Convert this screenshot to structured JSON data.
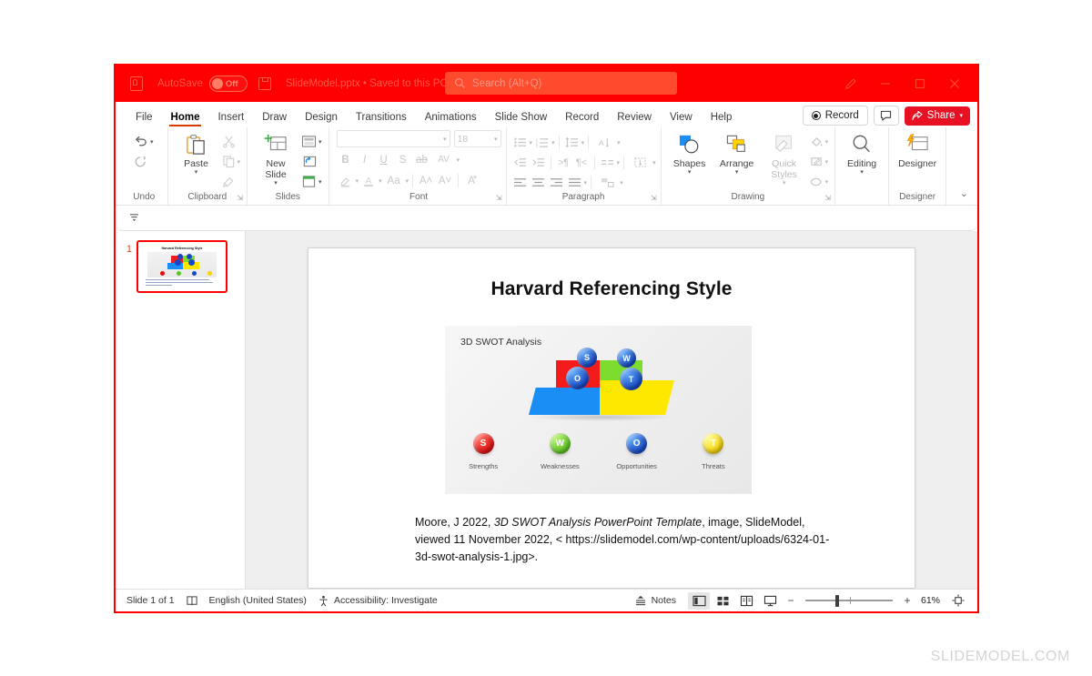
{
  "titlebar": {
    "app_icon": "powerpoint-icon",
    "autosave_label": "AutoSave",
    "autosave_state": "Off",
    "save_icon": "save-icon",
    "document_title": "SlideModel.pptx  •  Saved to this PC",
    "search_placeholder": "Search (Alt+Q)",
    "brand_color": "#ff0000",
    "window_controls": [
      "ribbon-display-options",
      "minimize",
      "maximize",
      "close"
    ]
  },
  "tabs": [
    {
      "label": "File",
      "active": false
    },
    {
      "label": "Home",
      "active": true
    },
    {
      "label": "Insert",
      "active": false
    },
    {
      "label": "Draw",
      "active": false
    },
    {
      "label": "Design",
      "active": false
    },
    {
      "label": "Transitions",
      "active": false
    },
    {
      "label": "Animations",
      "active": false
    },
    {
      "label": "Slide Show",
      "active": false
    },
    {
      "label": "Record",
      "active": false
    },
    {
      "label": "Review",
      "active": false
    },
    {
      "label": "View",
      "active": false
    },
    {
      "label": "Help",
      "active": false
    }
  ],
  "tab_actions": {
    "record_label": "Record",
    "comment_icon": "comment-icon",
    "share_label": "Share",
    "share_color": "#e81123"
  },
  "ribbon": {
    "groups": [
      {
        "label": "Undo"
      },
      {
        "label": "Clipboard"
      },
      {
        "label": "Slides"
      },
      {
        "label": "Font"
      },
      {
        "label": "Paragraph"
      },
      {
        "label": "Drawing"
      },
      {
        "label": "Designer"
      }
    ],
    "undo": {
      "undo_icon": "undo-icon",
      "redo_icon": "redo-icon"
    },
    "clipboard": {
      "paste_label": "Paste",
      "cut_icon": "scissors-icon",
      "copy_icon": "copy-icon",
      "format_painter_icon": "format-painter-icon"
    },
    "slides": {
      "new_slide_label": "New\nSlide",
      "layout_icon": "layout-icon",
      "reset_icon": "reset-icon",
      "section_icon": "section-icon"
    },
    "font": {
      "font_name": "",
      "font_size": "18",
      "bold": "B",
      "italic": "I",
      "underline": "U",
      "strikethrough": "S",
      "text_shadow_icon": "text-shadow-icon",
      "character_spacing": "AV",
      "text_highlight_icon": "text-highlight-icon",
      "font_color_icon": "font-color-icon",
      "change_case": "Aa",
      "increase_size": "A",
      "decrease_size": "A",
      "clear_formatting_icon": "clear-formatting-icon"
    },
    "drawing": {
      "shapes_label": "Shapes",
      "arrange_label": "Arrange",
      "quick_styles_label": "Quick\nStyles"
    },
    "editing": {
      "label": "Editing"
    },
    "designer": {
      "label": "Designer"
    },
    "collapse_icon": "chevron-down-icon"
  },
  "thumbnail_pane": {
    "slides": [
      {
        "number": "1",
        "selected": true,
        "title": "Harvard Referencing Style"
      }
    ]
  },
  "slide": {
    "title": "Harvard Referencing Style",
    "picture": {
      "caption": "3D SWOT Analysis",
      "quadrants": [
        {
          "letter": "S",
          "color": "#f41b1b"
        },
        {
          "letter": "W",
          "color": "#7ddd2e"
        },
        {
          "letter": "O",
          "color": "#1a8ef5"
        },
        {
          "letter": "T",
          "color": "#ffe800"
        }
      ],
      "legend": [
        {
          "letter": "S",
          "label": "Strengths",
          "color": "#e00d0d"
        },
        {
          "letter": "W",
          "label": "Weaknesses",
          "color": "#5cc421"
        },
        {
          "letter": "O",
          "label": "Opportunities",
          "color": "#1548c8"
        },
        {
          "letter": "T",
          "label": "Threats",
          "color": "#f5d500"
        }
      ]
    },
    "citation": {
      "part1": "Moore, J 2022, ",
      "italic": "3D SWOT Analysis PowerPoint Template",
      "part2": ", image, SlideModel, viewed 11 November 2022, < https://slidemodel.com/wp-content/uploads/6324-01-3d-swot-analysis-1.jpg>."
    }
  },
  "statusbar": {
    "slide_count": "Slide 1 of 1",
    "accessibility_checker_icon": "accessibility-book-icon",
    "language": "English (United States)",
    "accessibility": "Accessibility: Investigate",
    "notes_label": "Notes",
    "views": [
      {
        "name": "normal-view",
        "active": true
      },
      {
        "name": "slide-sorter-view",
        "active": false
      },
      {
        "name": "reading-view",
        "active": false
      },
      {
        "name": "slide-show-view",
        "active": false
      }
    ],
    "zoom_out": "−",
    "zoom_in": "+",
    "zoom_level": "61%",
    "fit_slide_icon": "fit-to-window-icon"
  },
  "watermark": "SLIDEMODEL.COM"
}
